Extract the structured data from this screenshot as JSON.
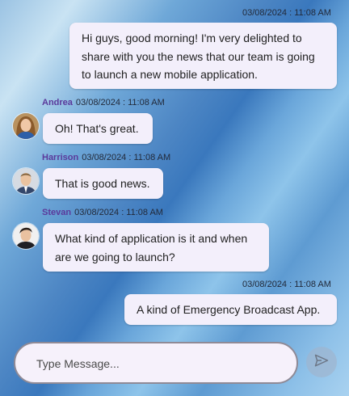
{
  "messages": [
    {
      "author": "",
      "timestamp": "03/08/2024 : 11:08 AM",
      "text": "Hi guys, good morning! I'm very delighted to share with you the news that our team is going to launch a new mobile application."
    },
    {
      "author": "Andrea",
      "timestamp": "03/08/2024 : 11:08 AM",
      "text": "Oh! That's great."
    },
    {
      "author": "Harrison",
      "timestamp": "03/08/2024 : 11:08 AM",
      "text": "That is good news."
    },
    {
      "author": "Stevan",
      "timestamp": "03/08/2024 : 11:08 AM",
      "text": "What kind of application is it and when are we going to launch?"
    },
    {
      "author": "",
      "timestamp": "03/08/2024 : 11:08 AM",
      "text": "A kind of Emergency Broadcast App."
    }
  ],
  "composer": {
    "placeholder": "Type Message..."
  },
  "icons": {
    "send": "send-icon",
    "avatars": [
      "andrea-avatar",
      "harrison-avatar",
      "stevan-avatar"
    ]
  }
}
